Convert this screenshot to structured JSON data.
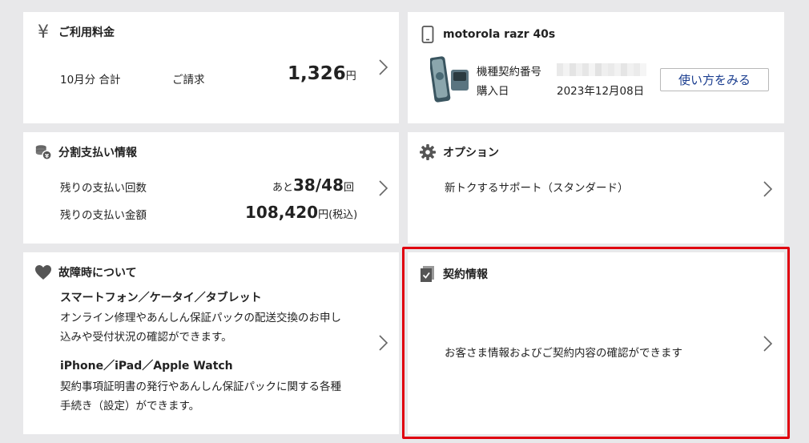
{
  "billing": {
    "title": "ご利用料金",
    "period": "10月分 合計",
    "label": "ご請求",
    "amount": "1,326",
    "unit": "円"
  },
  "device": {
    "title": "motorola razr 40s",
    "serial_label": "機種契約番号",
    "purchase_label": "購入日",
    "purchase_date": "2023年12月08日",
    "how_to_button": "使い方をみる"
  },
  "installment": {
    "title": "分割支払い情報",
    "count_label": "残りの支払い回数",
    "count_prefix": "あと",
    "count_value": "38/48",
    "count_unit": "回",
    "amount_label": "残りの支払い金額",
    "amount_value": "108,420",
    "amount_unit": "円(税込)"
  },
  "options": {
    "title": "オプション",
    "item": "新トクするサポート（スタンダード）"
  },
  "trouble": {
    "title": "故障時について",
    "section1_heading": "スマートフォン／ケータイ／タブレット",
    "section1_line1": "オンライン修理やあんしん保証パックの配送交換のお申し",
    "section1_line2": "込みや受付状況の確認ができます。",
    "section2_heading": "iPhone／iPad／Apple Watch",
    "section2_line1": "契約事項証明書の発行やあんしん保証パックに関する各種",
    "section2_line2": "手続き（設定）ができます。"
  },
  "contract": {
    "title": "契約情報",
    "description": "お客さま情報およびご契約内容の確認ができます"
  },
  "colors": {
    "background": "#e8e8ea",
    "highlight": "#e00010",
    "button_text": "#1a3d8f"
  }
}
